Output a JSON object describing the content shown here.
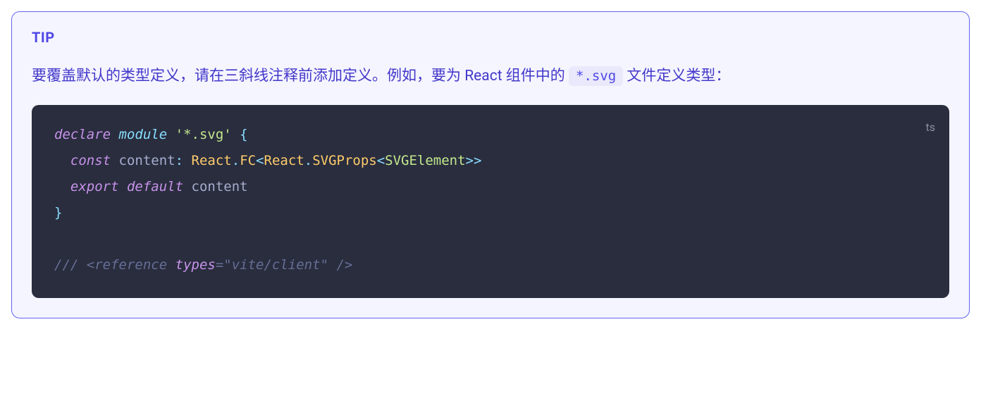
{
  "tip": {
    "title": "TIP",
    "description_before": "要覆盖默认的类型定义，请在三斜线注释前添加定义。例如，要为 React 组件中的 ",
    "inline_code": "*.svg",
    "description_after": " 文件定义类型：",
    "code_lang": "ts",
    "code": {
      "line1": {
        "declare": "declare",
        "module": "module",
        "string": "'*.svg'",
        "brace_open": "{"
      },
      "line2": {
        "const": "const",
        "var": "content",
        "colon": ":",
        "react": "React",
        "dot1": ".",
        "fc": "FC",
        "lt1": "<",
        "react2": "React",
        "dot2": ".",
        "svgprops": "SVGProps",
        "lt2": "<",
        "svgelement": "SVGElement",
        "gt2": ">",
        "gt1": ">"
      },
      "line3": {
        "export": "export",
        "default": "default",
        "content": "content"
      },
      "line4": {
        "brace_close": "}"
      },
      "line6": {
        "slashes": "///",
        "lt": "<",
        "reference": "reference",
        "types_attr": "types",
        "eq": "=",
        "value": "\"vite/client\"",
        "slash_gt": "/>"
      }
    }
  }
}
